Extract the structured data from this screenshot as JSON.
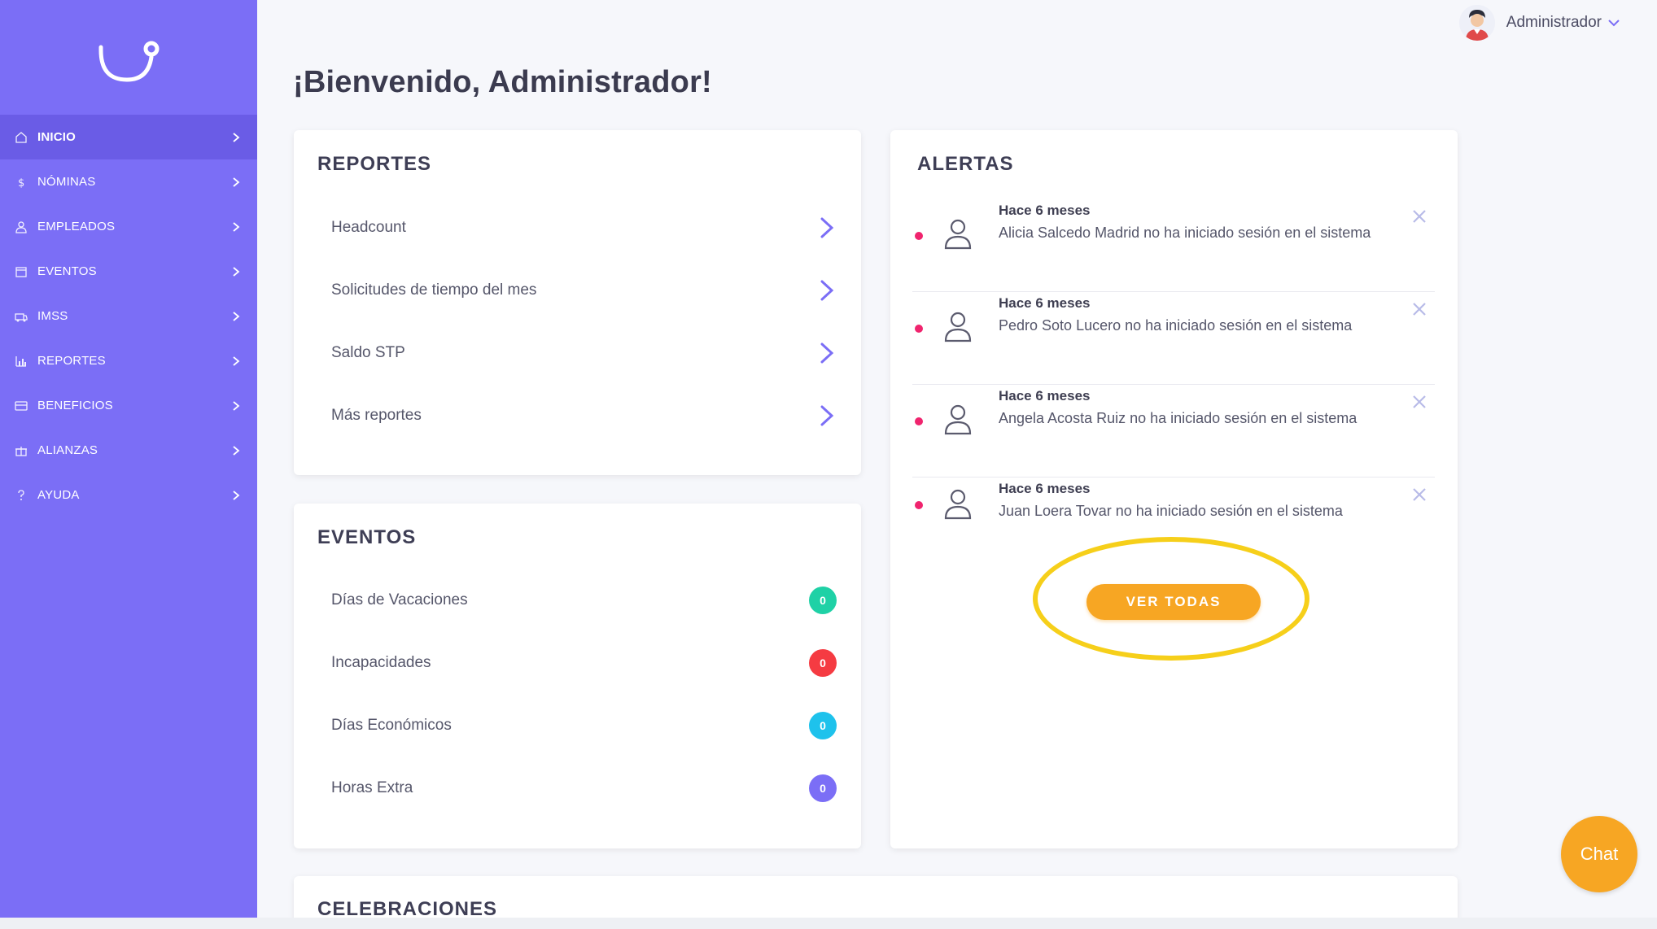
{
  "brand": {
    "accent": "#7b6ef6",
    "active": "#6a5ce6",
    "orange": "#f7a623",
    "highlight": "#f6cf1a"
  },
  "sidebar": {
    "items": [
      {
        "label": "INICIO",
        "icon": "home-icon",
        "active": true
      },
      {
        "label": "NÓMINAS",
        "icon": "dollar-icon",
        "active": false
      },
      {
        "label": "EMPLEADOS",
        "icon": "user-icon",
        "active": false
      },
      {
        "label": "EVENTOS",
        "icon": "calendar-icon",
        "active": false
      },
      {
        "label": "IMSS",
        "icon": "ambulance-icon",
        "active": false
      },
      {
        "label": "REPORTES",
        "icon": "bar-chart-icon",
        "active": false
      },
      {
        "label": "BENEFICIOS",
        "icon": "card-icon",
        "active": false
      },
      {
        "label": "ALIANZAS",
        "icon": "gift-icon",
        "active": false
      },
      {
        "label": "AYUDA",
        "icon": "question-icon",
        "active": false
      }
    ]
  },
  "header": {
    "user_name": "Administrador"
  },
  "page": {
    "title": "¡Bienvenido, Administrador!"
  },
  "reportes": {
    "title": "REPORTES",
    "items": [
      "Headcount",
      "Solicitudes de tiempo del mes",
      "Saldo STP",
      "Más reportes"
    ]
  },
  "eventos": {
    "title": "EVENTOS",
    "items": [
      {
        "label": "Días de Vacaciones",
        "count": "0",
        "color": "#1fd1a6"
      },
      {
        "label": "Incapacidades",
        "count": "0",
        "color": "#f53b42"
      },
      {
        "label": "Días Económicos",
        "count": "0",
        "color": "#1ec2ec"
      },
      {
        "label": "Horas Extra",
        "count": "0",
        "color": "#7b6ef6"
      }
    ]
  },
  "alertas": {
    "title": "ALERTAS",
    "items": [
      {
        "time": "Hace 6 meses",
        "text": "Alicia Salcedo Madrid no ha iniciado sesión en el sistema"
      },
      {
        "time": "Hace 6 meses",
        "text": "Pedro Soto Lucero no ha iniciado sesión en el sistema"
      },
      {
        "time": "Hace 6 meses",
        "text": "Angela Acosta Ruiz no ha iniciado sesión en el sistema"
      },
      {
        "time": "Hace 6 meses",
        "text": "Juan Loera Tovar no ha iniciado sesión en el sistema"
      }
    ],
    "ver_todas": "VER TODAS"
  },
  "celebraciones": {
    "title": "CELEBRACIONES"
  },
  "chat": {
    "label": "Chat"
  }
}
